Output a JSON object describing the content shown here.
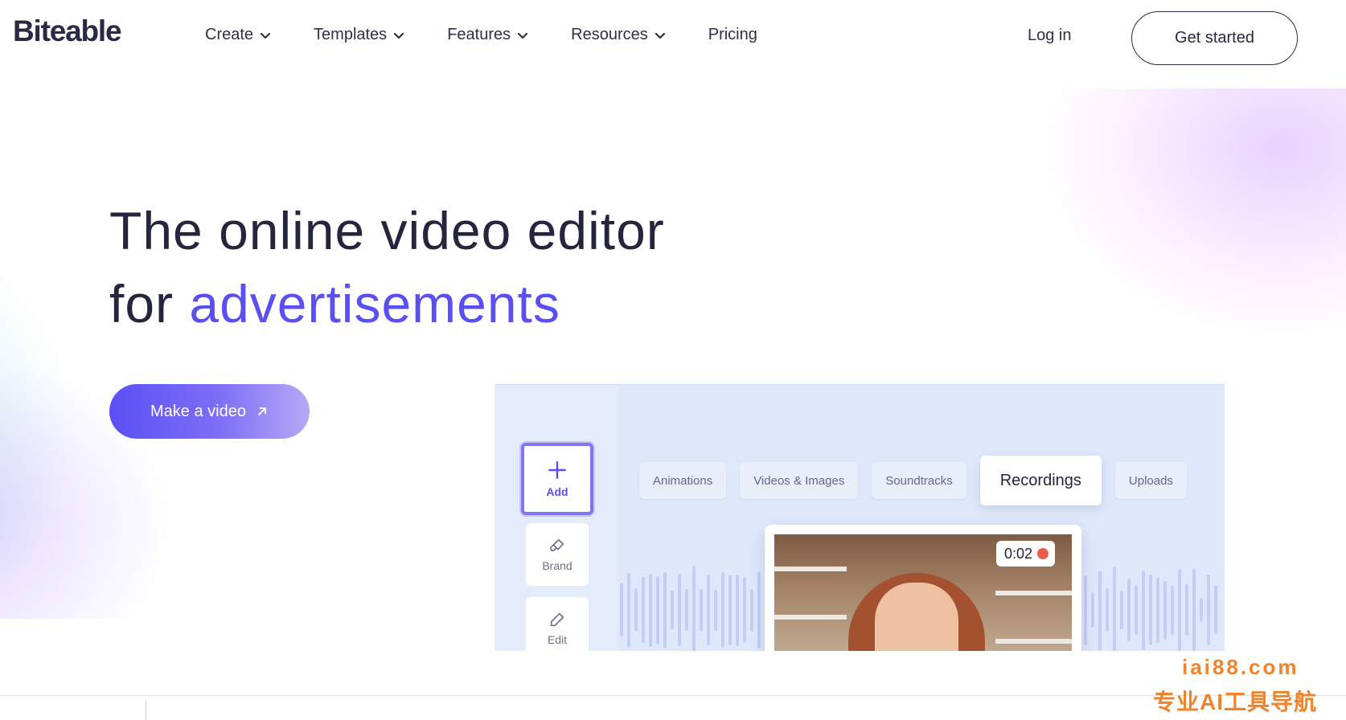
{
  "header": {
    "logo": "Biteable",
    "nav": [
      {
        "label": "Create",
        "has_dropdown": true
      },
      {
        "label": "Templates",
        "has_dropdown": true
      },
      {
        "label": "Features",
        "has_dropdown": true
      },
      {
        "label": "Resources",
        "has_dropdown": true
      },
      {
        "label": "Pricing",
        "has_dropdown": false
      }
    ],
    "login_label": "Log in",
    "get_started_label": "Get started"
  },
  "hero": {
    "title_line1": "The online video editor",
    "title_line2_prefix": "for ",
    "title_line2_accent": "advertisements",
    "cta_label": "Make a video"
  },
  "editor": {
    "tools": [
      {
        "label": "Add",
        "icon": "plus-icon"
      },
      {
        "label": "Brand",
        "icon": "brush-icon"
      },
      {
        "label": "Edit",
        "icon": "pencil-icon"
      },
      {
        "label": "",
        "icon": "share-icon"
      }
    ],
    "tabs": [
      {
        "label": "Animations",
        "active": false
      },
      {
        "label": "Videos & Images",
        "active": false
      },
      {
        "label": "Soundtracks",
        "active": false
      },
      {
        "label": "Recordings",
        "active": true
      },
      {
        "label": "Uploads",
        "active": false
      }
    ],
    "recording_time": "0:02"
  },
  "watermark": {
    "line1": "iai88.com",
    "line2": "专业AI工具导航"
  },
  "colors": {
    "accent": "#5a4ff3",
    "text_dark": "#25253d",
    "record": "#ec5d4b",
    "watermark": "#f0842c"
  }
}
